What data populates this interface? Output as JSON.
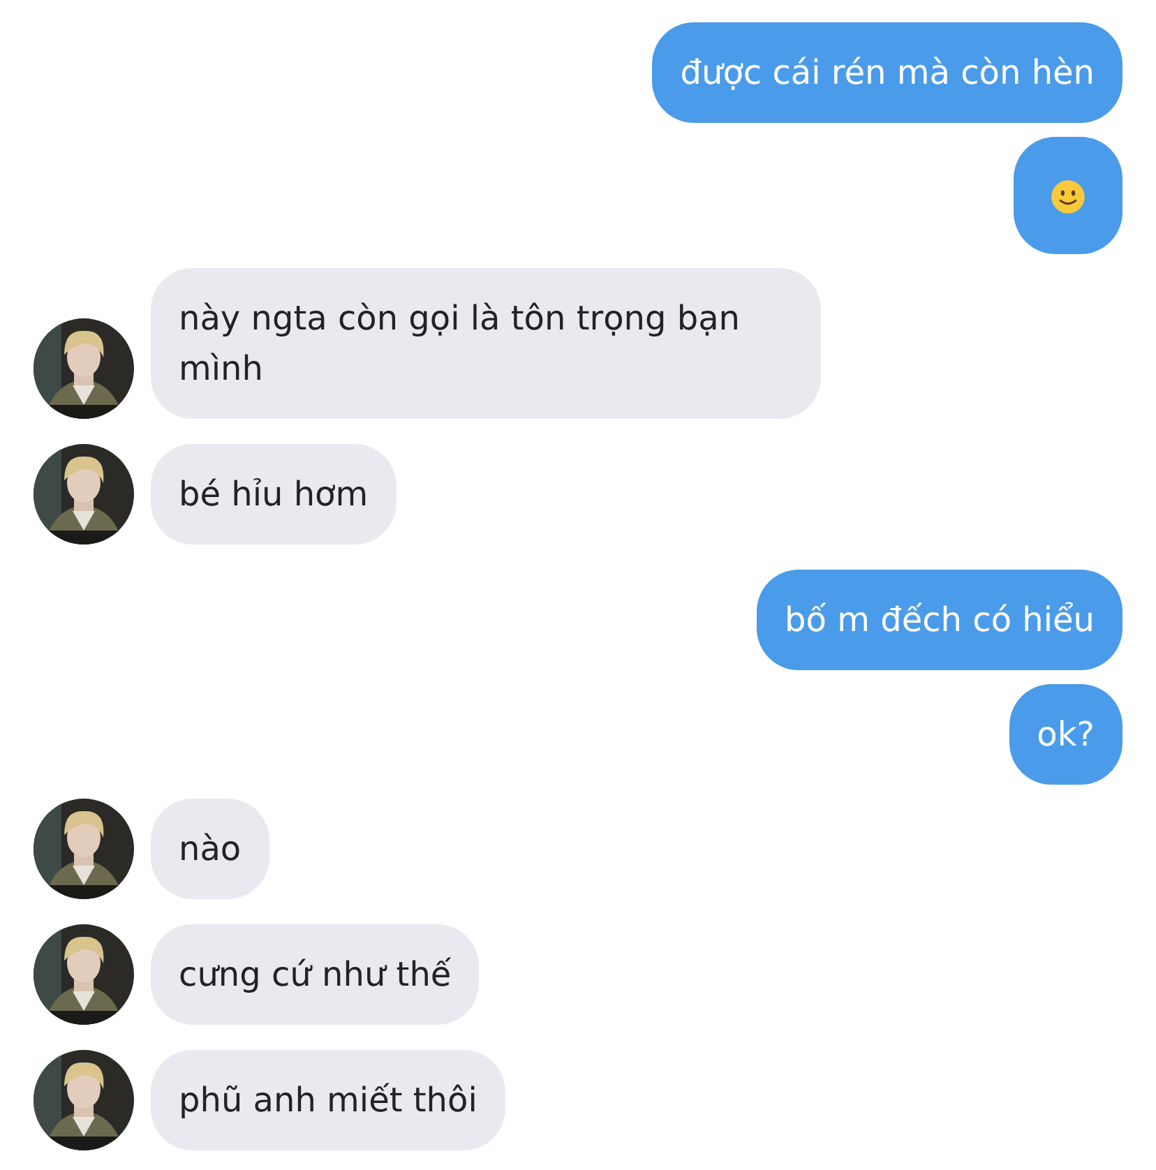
{
  "messages": [
    {
      "kind": "text",
      "sent": true,
      "text": "được cái rén mà còn hèn"
    },
    {
      "kind": "emoji",
      "sent": true
    },
    {
      "kind": "text",
      "sent": false,
      "text": "này ngta còn gọi là tôn trọng bạn mình"
    },
    {
      "kind": "text",
      "sent": false,
      "text": "bé hỉu hơm"
    },
    {
      "kind": "text",
      "sent": true,
      "text": "bố m đếch có hiểu"
    },
    {
      "kind": "text",
      "sent": true,
      "text": "ok?"
    },
    {
      "kind": "text",
      "sent": false,
      "text": "nào"
    },
    {
      "kind": "text",
      "sent": false,
      "text": "cưng cứ như thế"
    },
    {
      "kind": "text",
      "sent": false,
      "text": "phũ anh miết thôi"
    }
  ]
}
